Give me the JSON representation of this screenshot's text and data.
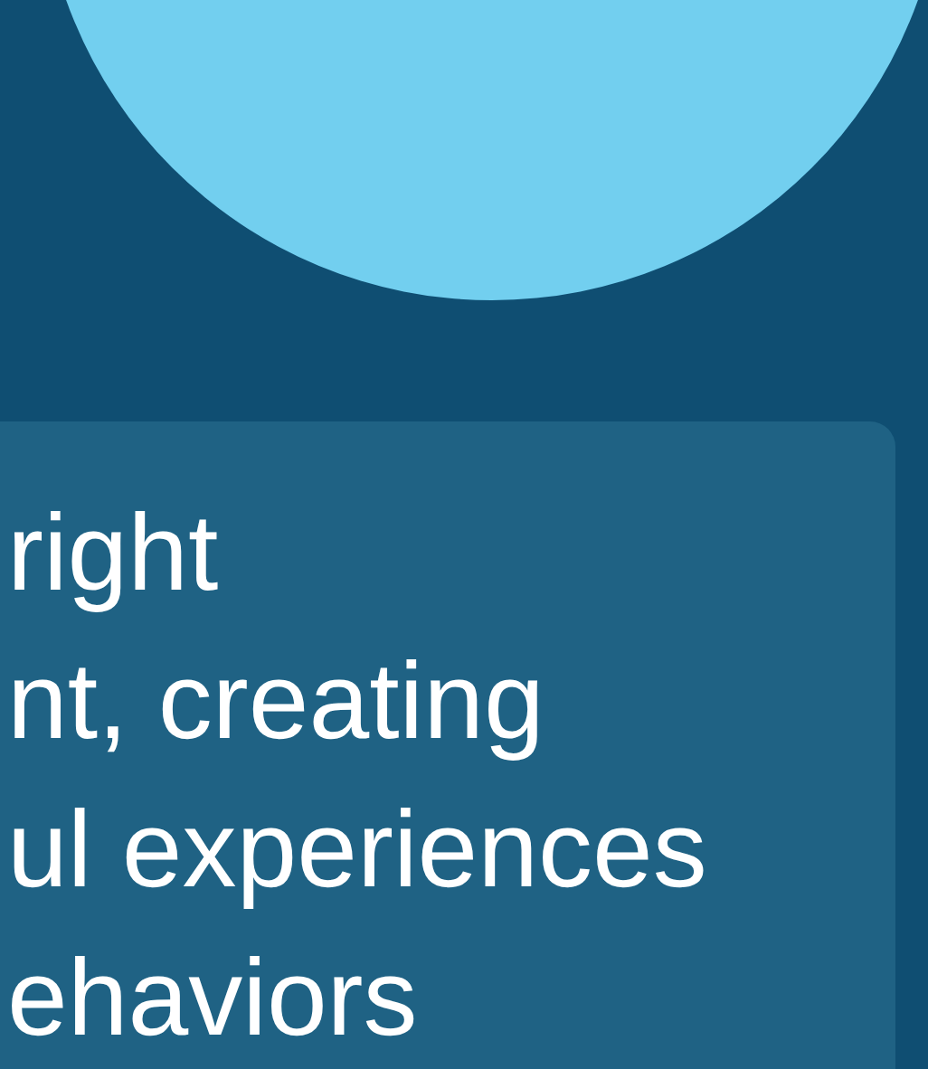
{
  "card": {
    "lines": [
      "right",
      "nt, creating",
      "ul experiences",
      "ehaviors"
    ]
  }
}
